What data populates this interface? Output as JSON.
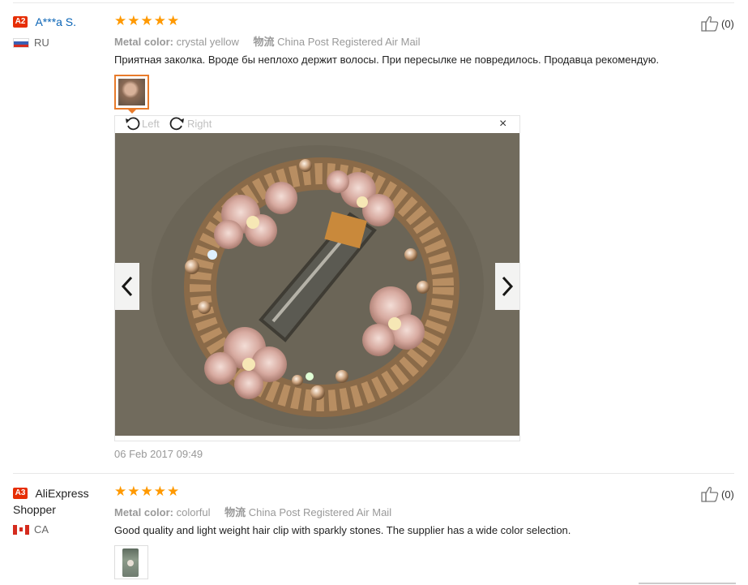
{
  "reviews": [
    {
      "badge": "A2",
      "name": "A***a S.",
      "country": "RU",
      "stars": "★★★★★",
      "color_label": "Metal color:",
      "color_value": "crystal yellow",
      "shipping_label": "物流",
      "shipping_value": "China Post Registered Air Mail",
      "text": "Приятная заколка. Вроде бы неплохо держит волосы. При пересылке не повредилось. Продавца рекомендую.",
      "likes": "(0)",
      "date": "06 Feb 2017 09:49"
    },
    {
      "badge": "A3",
      "name_line1": "AliExpress",
      "name_line2": "Shopper",
      "country": "CA",
      "stars": "★★★★★",
      "color_label": "Metal color:",
      "color_value": "colorful",
      "shipping_label": "物流",
      "shipping_value": "China Post Registered Air Mail",
      "text": "Good quality and light weight hair clip with sparkly stones. The supplier has a wide color selection.",
      "likes": "(0)"
    }
  ],
  "viewer": {
    "rotate_left": "Left",
    "rotate_right": "Right",
    "close": "×"
  },
  "colors": {
    "accent_orange": "#e87b2b",
    "star": "#ff9900",
    "badge_red": "#e62e04",
    "link_blue": "#0a64b6"
  },
  "icons": [
    "thumbs-up-icon",
    "rotate-left-icon",
    "rotate-right-icon",
    "close-icon",
    "chevron-left-icon",
    "chevron-right-icon"
  ]
}
